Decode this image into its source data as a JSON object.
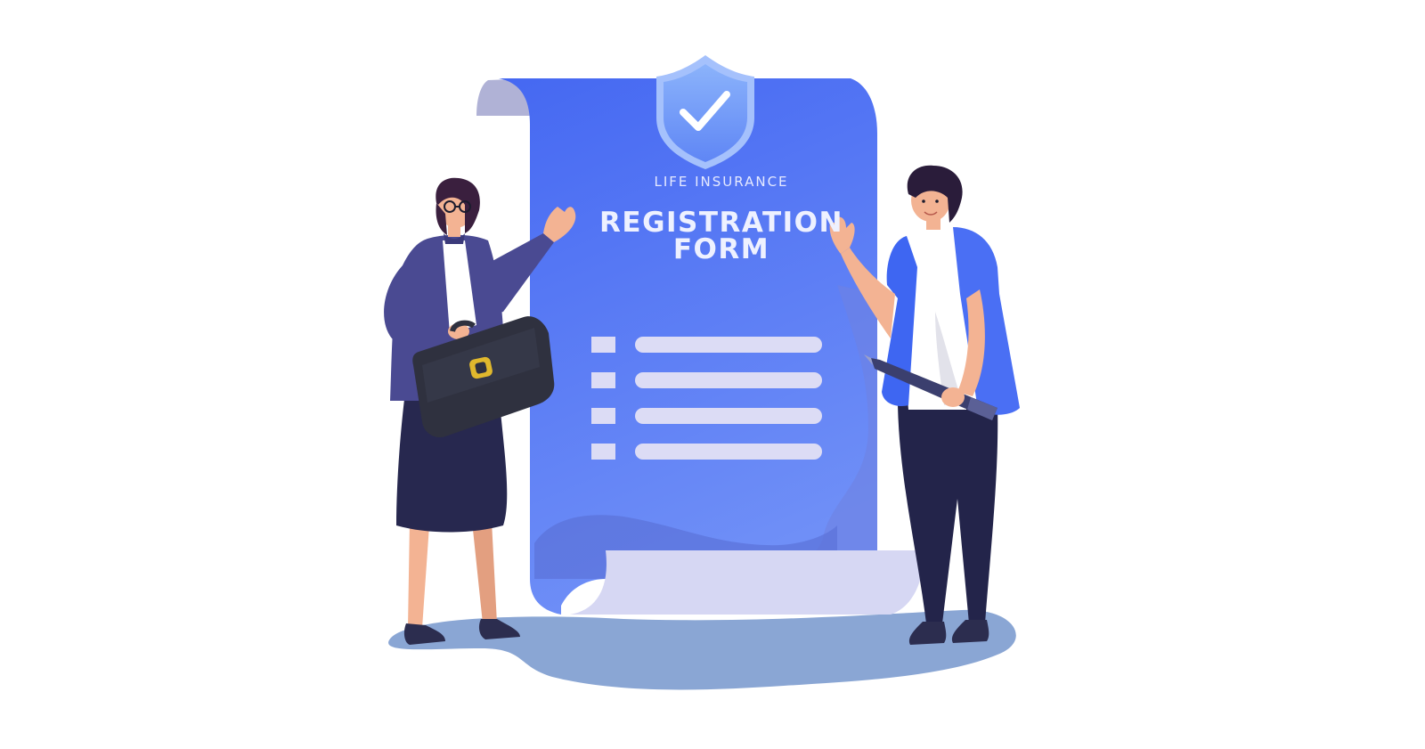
{
  "form": {
    "subtitle": "LIFE INSURANCE",
    "title_line1": "REGISTRATION",
    "title_line2": "FORM",
    "row_count": 4
  },
  "colors": {
    "document_blue": "#4d6bf3",
    "document_light": "#6f8ff7",
    "paper_curl": "#d6d7f3",
    "shield": "#6f97f8",
    "ground": "#8aa6d4",
    "woman_blazer": "#4a4a92",
    "woman_skirt": "#27284f",
    "briefcase": "#2f313f",
    "man_jacket": "#3e66f2",
    "man_pants": "#23244a",
    "skin": "#f3b393"
  },
  "icons": [
    "shield-check-icon",
    "briefcase-icon",
    "pen-icon"
  ]
}
